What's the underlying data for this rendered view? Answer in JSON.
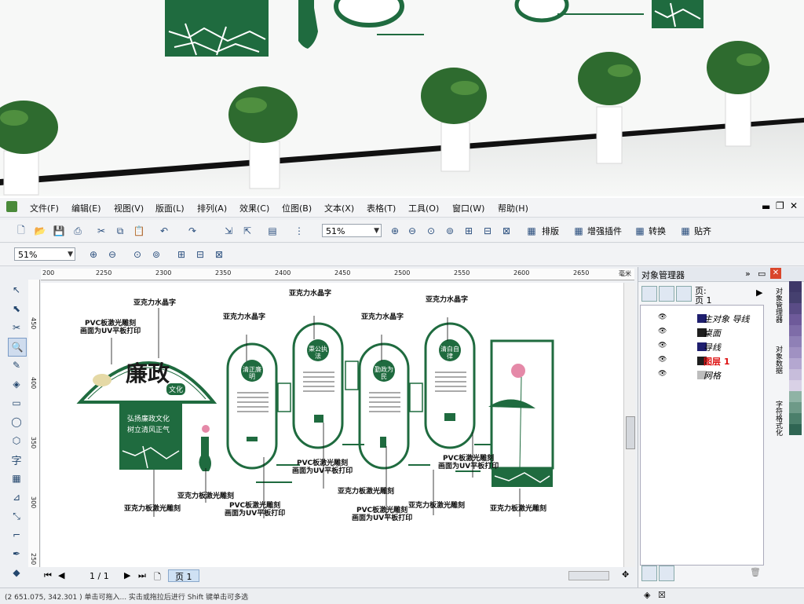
{
  "menu": [
    "文件(F)",
    "编辑(E)",
    "视图(V)",
    "版面(L)",
    "排列(A)",
    "效果(C)",
    "位图(B)",
    "文本(X)",
    "表格(T)",
    "工具(O)",
    "窗口(W)",
    "帮助(H)"
  ],
  "toolbar": {
    "zoom_value": "51%",
    "arrange_label": "排版",
    "plugin_label": "增强插件",
    "convert_label": "转换",
    "align_label": "贴齐"
  },
  "propertybar": {
    "zoom_value": "51%"
  },
  "ruler": {
    "h_ticks": [
      "200",
      "2250",
      "2300",
      "2350",
      "2400",
      "2450",
      "2500",
      "2550",
      "2600",
      "2650"
    ],
    "unit": "毫米",
    "v_ticks": [
      "450",
      "400",
      "350",
      "300",
      "250"
    ]
  },
  "docker": {
    "title": "对象管理器",
    "page_label_1": "页:",
    "page_label_2": "页 1",
    "layers": [
      {
        "name": "主对象 导线",
        "color": "#1e1e6e"
      },
      {
        "name": "桌面",
        "color": "#1e1e1e"
      },
      {
        "name": "导线",
        "color": "#1e1e6e"
      },
      {
        "name": "图层 1",
        "color": "#1e1e1e",
        "active": true
      },
      {
        "name": "网格",
        "color": "#bdbdbd"
      }
    ],
    "side_tabs": [
      "对象管理器",
      "对象数据",
      "字符格式化"
    ]
  },
  "pagebar": {
    "counter": "1 / 1",
    "tab_label": "页 1"
  },
  "status": {
    "text": "(2 651.075, 342.301 ) 单击可拖入... 实击或拖拉后进行 Shift 键单击可多选"
  },
  "design": {
    "fan_title": "廉政",
    "fan_subtitle": "文化",
    "slogan_1": "弘扬廉政文化",
    "slogan_2": "树立清风正气",
    "badge_1": "清正廉明",
    "badge_2": "秉公执法",
    "badge_3": "勤政为民",
    "badge_4": "清白自律"
  },
  "annotations": [
    {
      "text": "亚克力水晶字"
    },
    {
      "text": "PVC板激光雕刻"
    },
    {
      "text": "画面为UV平板打印"
    },
    {
      "text": "亚克力水晶字"
    },
    {
      "text": "亚克力水晶字"
    },
    {
      "text": "亚克力水晶字"
    },
    {
      "text": "亚克力水晶字"
    },
    {
      "text": "PVC板激光雕刻"
    },
    {
      "text": "画面为UV平板打印"
    },
    {
      "text": "PVC板激光雕刻"
    },
    {
      "text": "画面为UV平板打印"
    },
    {
      "text": "PVC板激光雕刻"
    },
    {
      "text": "画面为UV平板打印"
    },
    {
      "text": "PVC板激光雕刻"
    },
    {
      "text": "画面为UV平板打印"
    },
    {
      "text": "亚克力板激光雕刻"
    },
    {
      "text": "亚克力板激光雕刻"
    },
    {
      "text": "亚克力板激光雕刻"
    },
    {
      "text": "亚克力板激光雕刻"
    },
    {
      "text": "亚克力板激光雕刻"
    }
  ],
  "colors": {
    "accent": "#1f6b3f",
    "dark_green": "#0f5a35",
    "window_blue": "#2d4e7d"
  }
}
